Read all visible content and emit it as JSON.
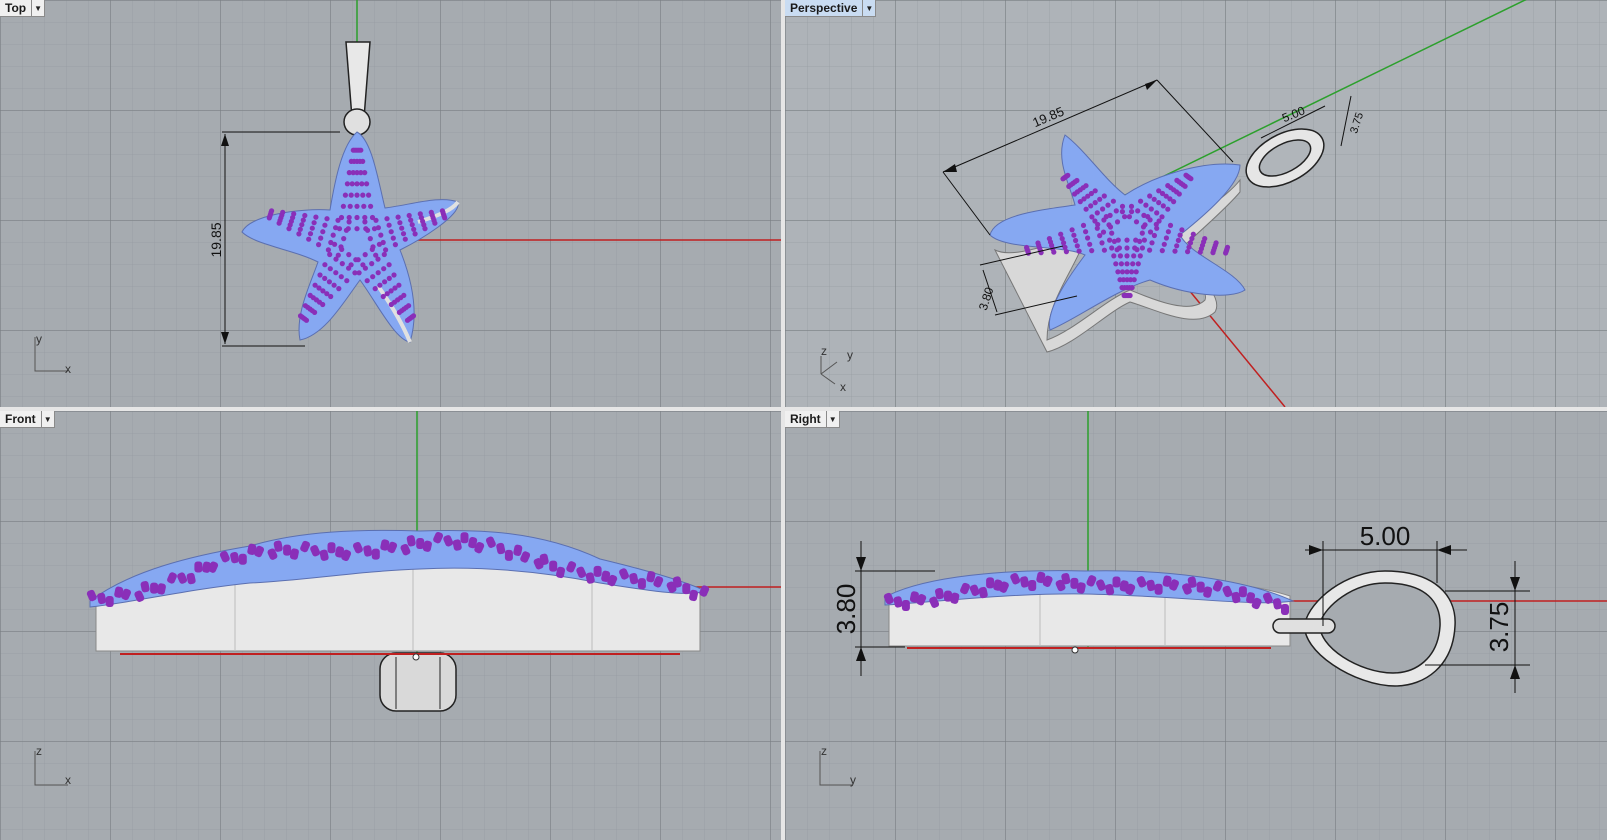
{
  "viewports": [
    {
      "label": "Top",
      "active": false
    },
    {
      "label": "Perspective",
      "active": true
    },
    {
      "label": "Front",
      "active": false
    },
    {
      "label": "Right",
      "active": false
    }
  ],
  "dimensions": {
    "overall_length": "19.85",
    "thickness": "3.80",
    "bail_width": "5.00",
    "bail_height": "3.75"
  },
  "axes": {
    "top": {
      "a": "y",
      "b": "x"
    },
    "perspective": {
      "a": "z",
      "b": "y",
      "c": "x"
    },
    "front": {
      "a": "z",
      "b": "x"
    },
    "right": {
      "a": "z",
      "b": "y"
    }
  },
  "colors": {
    "grid_bg": "#a6abb0",
    "gem_blue": "#86a8f2",
    "prong_purple": "#8a2fb8",
    "metal": "#e8e8e8",
    "x_axis": "#c02020",
    "y_axis": "#2ca02c",
    "active_label": "#c9dcf2"
  }
}
